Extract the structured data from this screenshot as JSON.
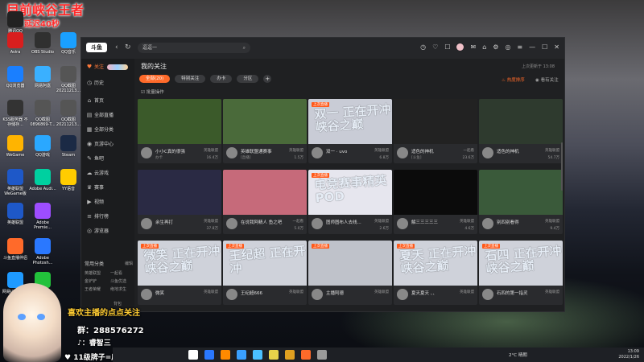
{
  "overlay": {
    "line1": "目前峡谷王者",
    "line2": "延迟40秒"
  },
  "desktop_icons": [
    {
      "label": "腾讯QQ",
      "color": "#222"
    },
    {
      "label": "Avira",
      "color": "#d81e1e"
    },
    {
      "label": "OBS Studio",
      "color": "#303030"
    },
    {
      "label": "QQ音乐",
      "color": "#1aa0ff"
    },
    {
      "label": "QQ浏览器",
      "color": "#1a7fff"
    },
    {
      "label": "网易阿嘉",
      "color": "#3ab0ff"
    },
    {
      "label": "QQ截图 20211213...",
      "color": "#555"
    },
    {
      "label": "KSS服务器 不存储存...",
      "color": "#333"
    },
    {
      "label": "QQ截图 0896869-T...",
      "color": "#555"
    },
    {
      "label": "QQ截图 20211213...",
      "color": "#555"
    },
    {
      "label": "WeGame",
      "color": "#ffb400"
    },
    {
      "label": "QQ游戏",
      "color": "#2aa8ff"
    },
    {
      "label": "Steam",
      "color": "#1b2a45"
    },
    {
      "label": "英雄联盟 WeGame版",
      "color": "#1e58c8"
    },
    {
      "label": "Adobe Audi...",
      "color": "#00d0a0"
    },
    {
      "label": "YY语音",
      "color": "#ffcc00"
    },
    {
      "label": "英雄联盟",
      "color": "#1e58c8"
    },
    {
      "label": "Adobe Premie...",
      "color": "#9d4dff"
    },
    {
      "label": "斗鱼直播伴侣",
      "color": "#ff6a2a"
    },
    {
      "label": "Adobe Photosh...",
      "color": "#2a78ff"
    },
    {
      "label": "网易UU加速器",
      "color": "#1e9aff"
    },
    {
      "label": "微信",
      "color": "#22c13b"
    }
  ],
  "app": {
    "title": "斗鱼",
    "nav_back": "‹",
    "nav_refresh": "↻",
    "search_placeholder": "逗逗一",
    "topbar_icons": [
      "clock-icon",
      "heart-icon",
      "gift-icon",
      "avatar-icon",
      "message-icon",
      "shirt-icon",
      "settings-icon",
      "record-icon",
      "menu-icon",
      "minimize-icon",
      "maximize-icon",
      "close-icon"
    ]
  },
  "sidebar": {
    "items": [
      {
        "label": "关注",
        "icon": "♥",
        "active": true
      },
      {
        "label": "历史",
        "icon": "◷"
      },
      {
        "label": "首页",
        "icon": "⌂"
      },
      {
        "label": "全部直播",
        "icon": "▤"
      },
      {
        "label": "全部分类",
        "icon": "▦"
      },
      {
        "label": "页游中心",
        "icon": "◉"
      },
      {
        "label": "鱼吧",
        "icon": "✎"
      },
      {
        "label": "云游戏",
        "icon": "☁"
      },
      {
        "label": "赛事",
        "icon": "♛"
      },
      {
        "label": "视频",
        "icon": "▶"
      },
      {
        "label": "排行榜",
        "icon": "≡"
      },
      {
        "label": "游览器",
        "icon": "◎"
      }
    ],
    "fav_title": "常用分类",
    "fav_edit": "编辑",
    "fav_items": [
      [
        "英雄联盟",
        "一起看"
      ],
      [
        "金铲铲",
        "斗鱼优选"
      ],
      [
        "王者荣耀",
        "绝地求生"
      ]
    ],
    "fav_footer": "背包"
  },
  "main": {
    "title": "我的关注",
    "update_text": "上次更新于 13:08",
    "tabs": [
      "全部(20)",
      "特别关注",
      "办卡",
      "分区"
    ],
    "tab_plus": "+",
    "sort_label": "热度排序",
    "sort_label2": "看有关注",
    "batch_label": "批量操作"
  },
  "cards": [
    {
      "name": "小小C真的很强",
      "cat": "英雄联盟",
      "sub": "办卡",
      "heat": "16.4万",
      "thumb": "#3b5a2a"
    },
    {
      "name": "英雄联盟通赛事",
      "cat": "英雄联盟",
      "sub": "[直播]",
      "heat": "1.5万",
      "thumb": "#4a6a3a"
    },
    {
      "name": "双一 · uvo",
      "cat": "英雄联盟",
      "sub": "",
      "heat": "6.8万",
      "thumb": "#c9ccd6",
      "big": "双一 正在开冲 峡谷之巅",
      "badge": "上次直播"
    },
    {
      "name": "适色的神机",
      "cat": "一起看",
      "sub": "[斗鱼]",
      "heat": "23.6万",
      "thumb": "#222"
    },
    {
      "name": "适色的神机",
      "cat": "英雄联盟",
      "sub": "",
      "heat": "54.7万",
      "thumb": "#2e3a2e"
    },
    {
      "name": "余生再打",
      "cat": "英雄联盟",
      "sub": "",
      "heat": "37.8万",
      "thumb": "#2a2a44"
    },
    {
      "name": "在说我阿精人 鱼之吧...",
      "cat": "一起看",
      "sub": "",
      "heat": "5.0万",
      "thumb": "#c66a7a"
    },
    {
      "name": "图师图布人去线...",
      "cat": "英雄联盟",
      "sub": "",
      "heat": "2.6万",
      "thumb": "#e6e6ee",
      "big": "电竞赛事精英 POD",
      "badge": "上次直播"
    },
    {
      "name": "解三三三三三",
      "cat": "英雄联盟",
      "sub": "",
      "heat": "4.6万",
      "thumb": "#0b0b0b"
    },
    {
      "name": "别四别看得",
      "cat": "英雄联盟",
      "sub": "",
      "heat": "9.4万",
      "thumb": "#3a5a3a"
    },
    {
      "name": "微笑",
      "cat": "英雄联盟",
      "sub": "",
      "heat": "",
      "thumb": "#cfd2da",
      "big": "微笑 正在开冲 峡谷之巅",
      "badge": "上次直播"
    },
    {
      "name": "王纪超666",
      "cat": "英雄联盟",
      "sub": "",
      "heat": "",
      "thumb": "#cfd2da",
      "big": "王纪超 正在开冲",
      "badge": "上次直播"
    },
    {
      "name": "主播阿德",
      "cat": "英雄联盟",
      "sub": "",
      "heat": "",
      "thumb": "#bfc2ca",
      "badge": "上次直播"
    },
    {
      "name": "夏天夏天 、、",
      "cat": "英雄联盟",
      "sub": "",
      "heat": "",
      "thumb": "#cfd2da",
      "big": "夏天 正在开冲 峡谷之巅",
      "badge": "上次直播"
    },
    {
      "name": "石四的第一指灵",
      "cat": "英雄联盟",
      "sub": "",
      "heat": "",
      "thumb": "#cfd2da",
      "big": "石四 正在开冲 峡谷之巅",
      "badge": "上次直播"
    }
  ],
  "streamer": {
    "line1": "喜欢主播的点点关注",
    "line2": "群：288576272",
    "line3": "：睿智三",
    "line4": "11级牌子=房管"
  },
  "taskbar": {
    "weather": "2°C 晴朗",
    "time": "13:09",
    "date": "2022/1/26",
    "apps": [
      "#ffffff",
      "#2a78ff",
      "#ff8a00",
      "#3aa0ff",
      "#4ac0ff",
      "#e6d24a",
      "#e0a020",
      "#ff6a2a",
      "#9a9a9a"
    ]
  }
}
